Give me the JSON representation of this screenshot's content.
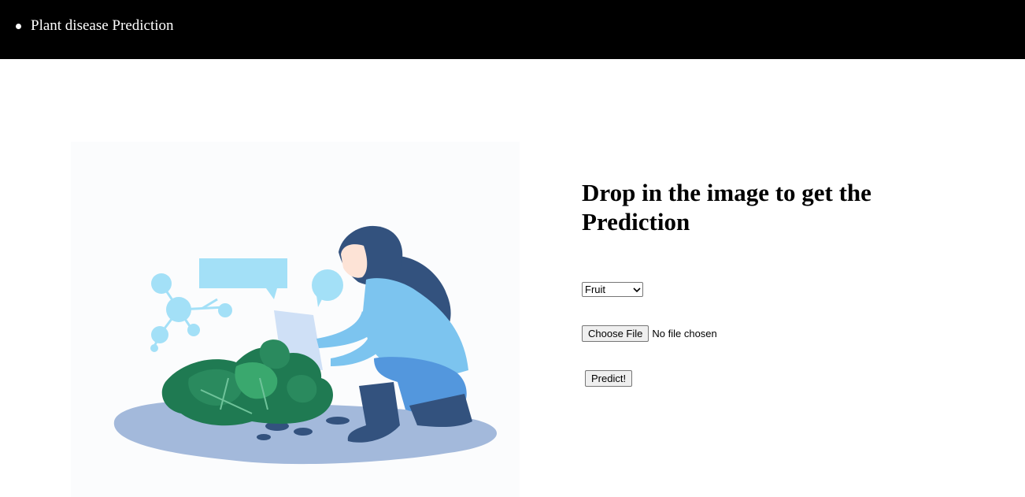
{
  "nav": {
    "items": [
      {
        "label": "Plant disease Prediction"
      }
    ]
  },
  "main": {
    "heading": "Drop in the image to get the Prediction",
    "category_select": {
      "selected": "Fruit",
      "icon": "chevron-down-icon"
    },
    "file_input": {
      "button_label": "Choose File",
      "status": "No file chosen"
    },
    "predict_button": "Predict!"
  },
  "colors": {
    "topbar": "#000000",
    "background": "#ffffff",
    "illustration_shirt": "#7cc4ef",
    "illustration_hair": "#33527e",
    "illustration_leaves": "#2a8a5e"
  }
}
